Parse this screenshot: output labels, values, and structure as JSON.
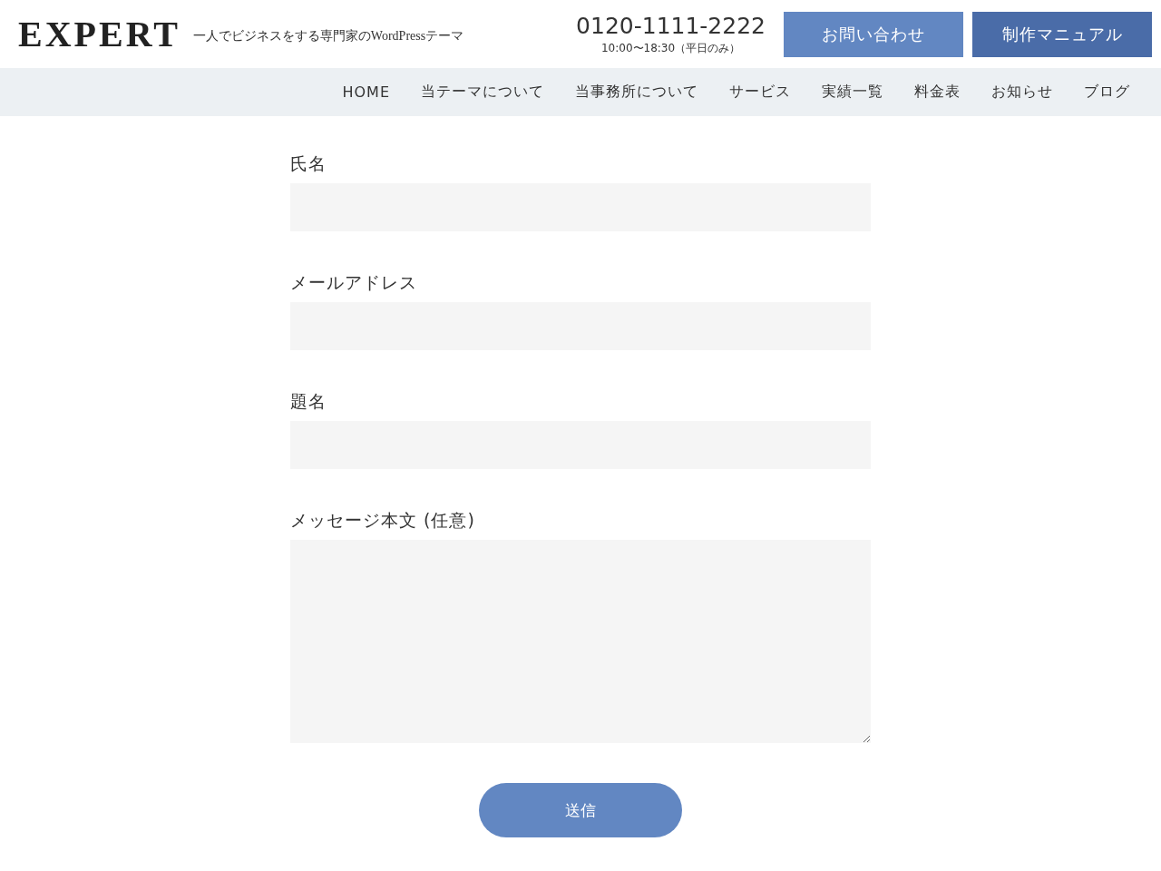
{
  "header": {
    "logo": "EXPERT",
    "tagline": "一人でビジネスをする専門家のWordPressテーマ",
    "phone": "0120-1111-2222",
    "hours": "10:00〜18:30（平日のみ）",
    "buttons": [
      {
        "label": "お問い合わせ",
        "kind": "primary"
      },
      {
        "label": "制作マニュアル",
        "kind": "secondary"
      }
    ]
  },
  "nav": {
    "items": [
      {
        "label": "HOME"
      },
      {
        "label": "当テーマについて"
      },
      {
        "label": "当事務所について"
      },
      {
        "label": "サービス"
      },
      {
        "label": "実績一覧"
      },
      {
        "label": "料金表"
      },
      {
        "label": "お知らせ"
      },
      {
        "label": "ブログ"
      }
    ]
  },
  "form": {
    "fields": [
      {
        "label": "氏名",
        "kind": "input"
      },
      {
        "label": "メールアドレス",
        "kind": "input"
      },
      {
        "label": "題名",
        "kind": "input"
      },
      {
        "label": "メッセージ本文 (任意)",
        "kind": "textarea"
      }
    ],
    "submit": "送信"
  }
}
